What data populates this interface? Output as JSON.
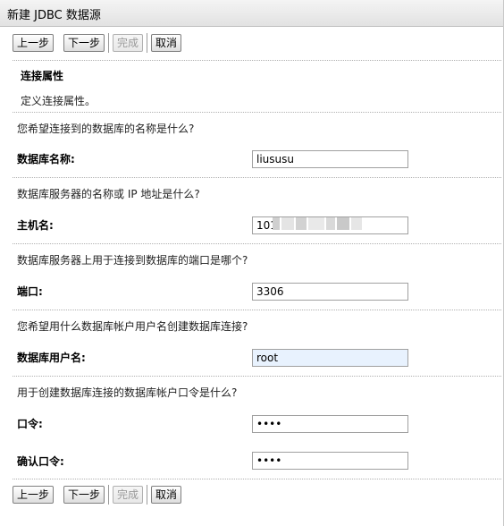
{
  "window": {
    "title": "新建 JDBC 数据源"
  },
  "toolbar": {
    "back_label": "上一步",
    "next_label": "下一步",
    "finish_label": "完成",
    "cancel_label": "取消"
  },
  "section": {
    "title": "连接属性",
    "description": "定义连接属性。"
  },
  "fields": {
    "database_name": {
      "question": "您希望连接到的数据库的名称是什么?",
      "label": "数据库名称:",
      "value": "liususu"
    },
    "host_name": {
      "question": "数据库服务器的名称或 IP 地址是什么?",
      "label": "主机名:",
      "value": "101"
    },
    "port": {
      "question": "数据库服务器上用于连接到数据库的端口是哪个?",
      "label": "端口:",
      "value": "3306"
    },
    "username": {
      "question": "您希望用什么数据库帐户用户名创建数据库连接?",
      "label": "数据库用户名:",
      "value": "root"
    },
    "password": {
      "question": "用于创建数据库连接的数据库帐户口令是什么?",
      "label": "口令:",
      "value": "••••"
    },
    "confirm_password": {
      "label": "确认口令:",
      "value": "••••"
    }
  }
}
